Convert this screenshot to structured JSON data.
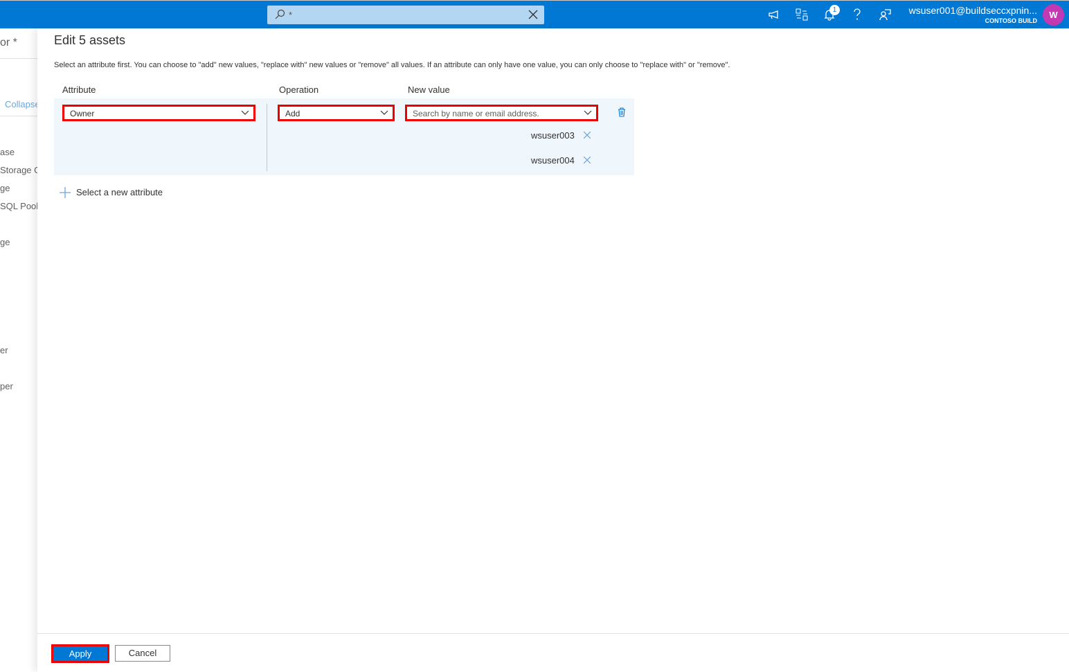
{
  "topbar": {
    "search_value": "*",
    "notification_count": "1",
    "user_name": "wsuser001@buildseccxpnin...",
    "org": "CONTOSO BUILD",
    "avatar_initial": "W",
    "icons": [
      "search-icon",
      "clear-icon",
      "feedback-megaphone-icon",
      "directory-switch-icon",
      "bell-icon",
      "help-icon",
      "feedback-icon"
    ]
  },
  "sidebar": {
    "items": [
      "or *",
      "Collapse",
      "ase",
      "Storage G",
      "ge",
      "SQL Pool",
      "ge",
      "er",
      "per"
    ]
  },
  "panel": {
    "title": "Edit 5 assets",
    "description": "Select an attribute first. You can choose to \"add\" new values, \"replace with\" new values or \"remove\" all values. If an attribute can only have one value, you can only choose to \"replace with\" or \"remove\".",
    "headers": {
      "attribute": "Attribute",
      "operation": "Operation",
      "new_value": "New value"
    },
    "row": {
      "attribute": "Owner",
      "operation": "Add",
      "new_value_placeholder": "Search by name or email address.",
      "values": [
        "wsuser003",
        "wsuser004"
      ]
    },
    "add_attribute": "Select a new attribute",
    "apply": "Apply",
    "cancel": "Cancel"
  },
  "colors": {
    "brand": "#0078d4",
    "highlight": "#e00000",
    "row_bg": "#eff6fc",
    "avatar": "#c239b3"
  }
}
